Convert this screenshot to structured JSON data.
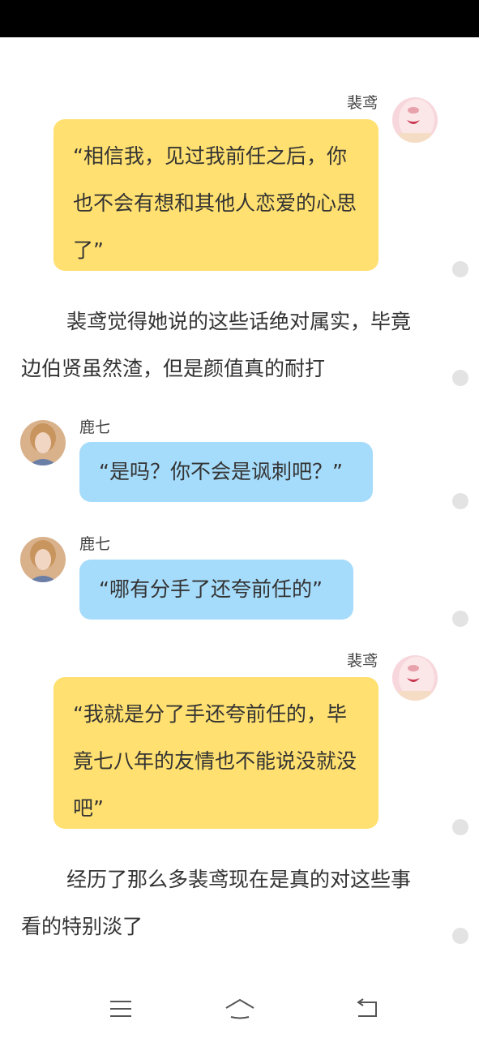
{
  "messages": [
    {
      "sender": "裴鸢",
      "text": "“相信我，见过我前任之后，你也不会有想和其他人恋爱的心思了”"
    },
    {
      "sender": "鹿七",
      "text": "“是吗？你不会是讽刺吧？”"
    },
    {
      "sender": "鹿七",
      "text": "“哪有分手了还夸前任的”"
    },
    {
      "sender": "裴鸢",
      "text": "“我就是分了手还夸前任的，毕竟七八年的友情也不能说没就没吧”"
    }
  ],
  "narration": [
    "裴鸢觉得她说的这些话绝对属实，毕竟边伯贤虽然渣，但是颜值真的耐打",
    "经历了那么多裴鸢现在是真的对这些事看的特别淡了"
  ],
  "colors": {
    "right_bubble": "#ffe070",
    "left_bubble": "#a6dcfb",
    "comment_dot": "#e3e3e3"
  },
  "nav": {
    "menu_icon": "menu-icon",
    "home_icon": "home-icon",
    "back_icon": "back-icon"
  }
}
